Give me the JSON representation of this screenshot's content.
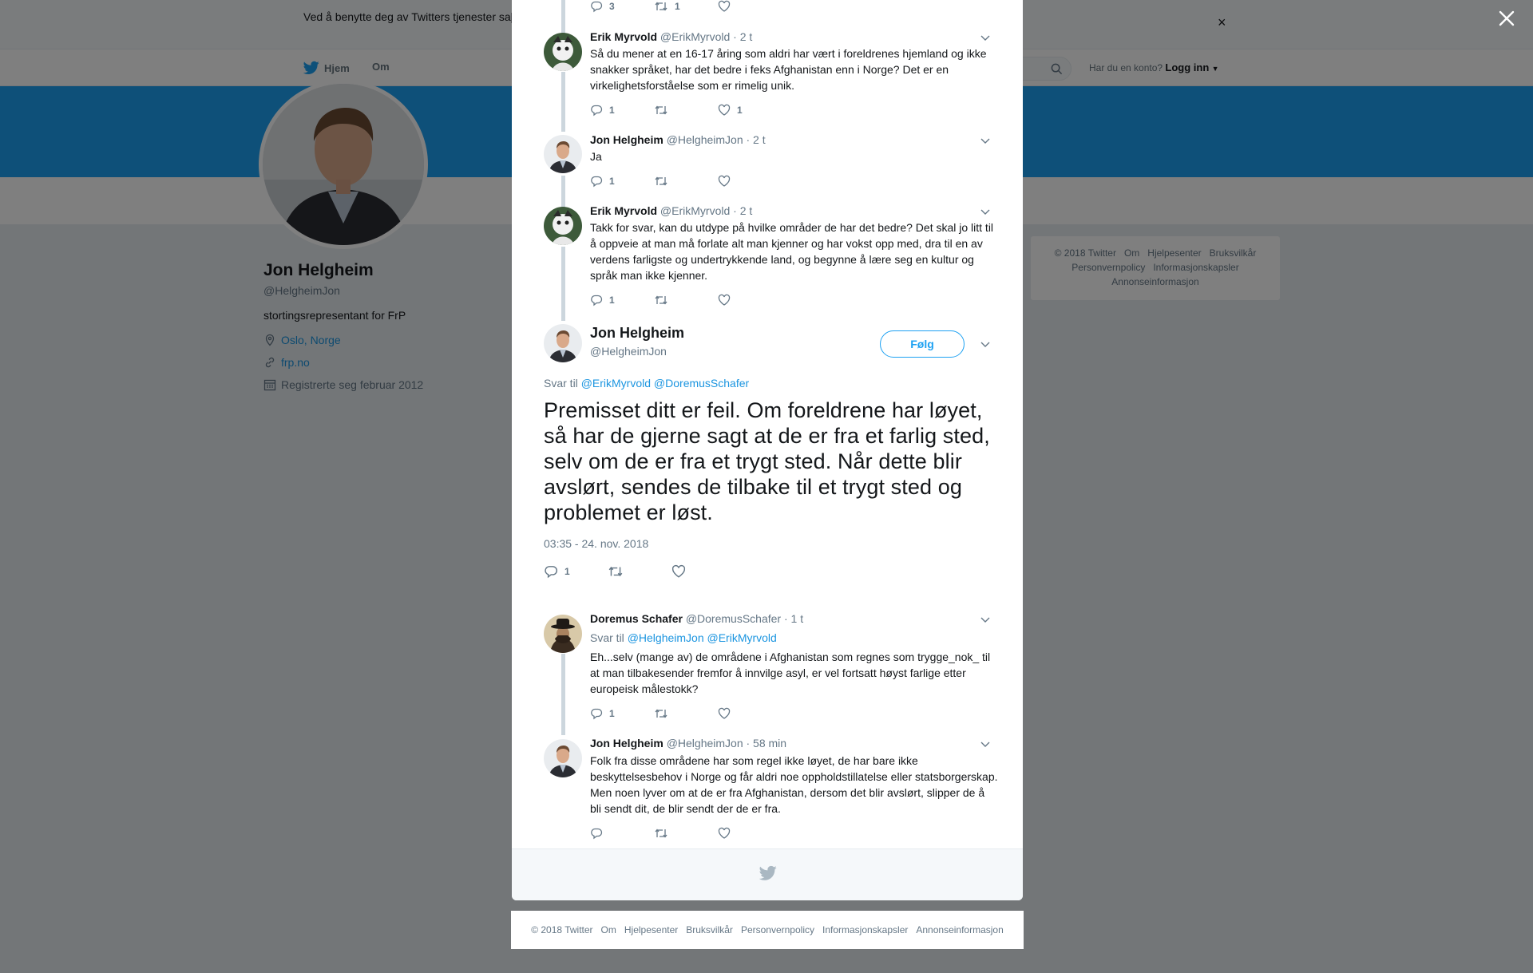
{
  "cookie_banner": {
    "text": "Ved å benytte deg av Twitters tjenester sa[...] informasjonskapsler til bl.a. analyser, personalisering og annonser."
  },
  "nav": {
    "home": "Hjem",
    "about": "Om",
    "account_prompt": "Har du en konto?",
    "login": "Logg inn"
  },
  "profile": {
    "name": "Jon Helgheim",
    "handle": "@HelgheimJon",
    "bio": "stortingsrepresentant for FrP",
    "location": "Oslo, Norge",
    "website": "frp.no",
    "joined": "Registrerte seg februar 2012"
  },
  "side_footer": {
    "links": [
      "© 2018 Twitter",
      "Om",
      "Hjelpesenter",
      "Bruksvilkår",
      "Personvernpolicy",
      "Informasjonskapsler",
      "Annonseinformasjon"
    ]
  },
  "thread": {
    "top_partial": {
      "reply_count": "3",
      "retweet_count": "1"
    },
    "tweets_above": [
      {
        "name": "Erik Myrvold",
        "handle": "@ErikMyrvold",
        "time": "· 2 t",
        "text": "Så du mener at en 16-17 åring som aldri har vært i foreldrenes hjemland og ikke snakker språket, har det bedre i feks Afghanistan enn i Norge? Det er en virkelighetsforståelse som er rimelig unik.",
        "replies": "1",
        "retweets": "",
        "likes": "1"
      },
      {
        "name": "Jon Helgheim",
        "handle": "@HelgheimJon",
        "time": "· 2 t",
        "text": "Ja",
        "replies": "1",
        "retweets": "",
        "likes": ""
      },
      {
        "name": "Erik Myrvold",
        "handle": "@ErikMyrvold",
        "time": "· 2 t",
        "text": "Takk for svar, kan du utdype på hvilke områder de har det bedre? Det skal jo litt til å oppveie at man må forlate alt man kjenner og har vokst opp med, dra til en av verdens farligste og undertrykkende land, og begynne å lære seg en kultur og språk man ikke kjenner.",
        "replies": "1",
        "retweets": "",
        "likes": ""
      }
    ],
    "main": {
      "name": "Jon Helgheim",
      "handle": "@HelgheimJon",
      "follow_label": "Følg",
      "reply_to_prefix": "Svar til",
      "reply_to_1": "@ErikMyrvold",
      "reply_to_2": "@DoremusSchafer",
      "text": "Premisset ditt er feil. Om foreldrene har løyet, så har de gjerne sagt at de er fra et farlig sted, selv om de er fra et trygt sted. Når dette blir avslørt, sendes de tilbake til et trygt sted og problemet er løst.",
      "timestamp": "03:35 - 24. nov. 2018",
      "replies": "1"
    },
    "replies_below": [
      {
        "name": "Doremus Schafer",
        "handle": "@DoremusSchafer",
        "time": "· 1 t",
        "reply_to_prefix": "Svar til",
        "reply_to_1": "@HelgheimJon",
        "reply_to_2": "@ErikMyrvold",
        "text": "Eh...selv (mange av) de områdene i Afghanistan som regnes som trygge_nok_ til at man tilbakesender fremfor å innvilge asyl, er vel fortsatt høyst farlige etter europeisk målestokk?",
        "replies": "1"
      },
      {
        "name": "Jon Helgheim",
        "handle": "@HelgheimJon",
        "time": "· 58 min",
        "text": "Folk fra disse områdene har som regel ikke løyet, de har bare ikke beskyttelsesbehov i Norge og får aldri noe oppholdstillatelse eller statsborgerskap. Men noen lyver om at de er fra Afghanistan, dersom det blir avslørt, slipper de å bli sendt dit, de blir sendt der de er fra.",
        "replies": ""
      }
    ]
  },
  "bottom_footer": {
    "links": [
      "© 2018 Twitter",
      "Om",
      "Hjelpesenter",
      "Bruksvilkår",
      "Personvernpolicy",
      "Informasjonskapsler",
      "Annonseinformasjon"
    ]
  },
  "colors": {
    "brand_blue": "#1da1f2",
    "link_blue": "#1b95e0",
    "muted": "#657786",
    "overlay": "rgba(0,0,0,0.5)"
  }
}
